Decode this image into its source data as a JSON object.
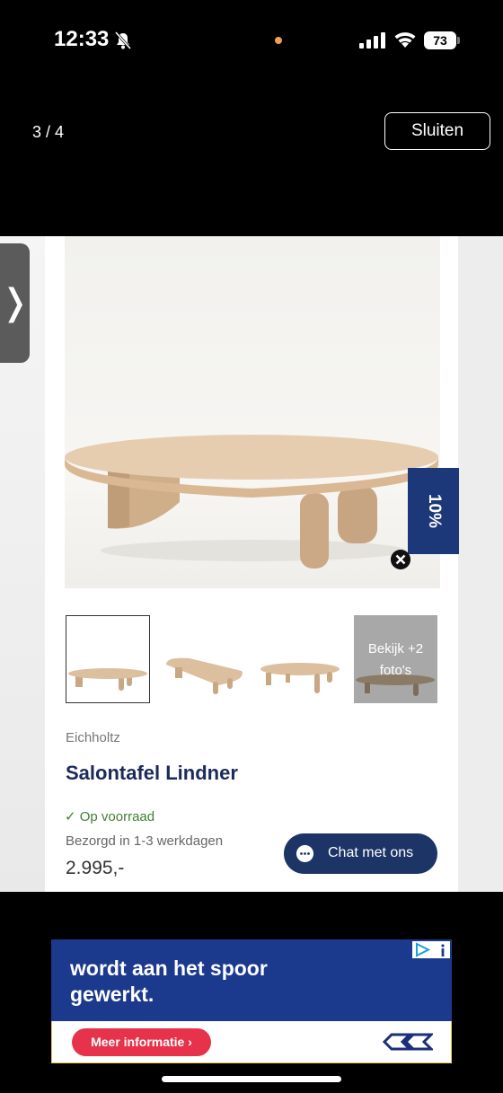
{
  "status_bar": {
    "time": "12:33",
    "battery": "73",
    "dot_color": "#f0a050",
    "icons": [
      "bell-muted-icon",
      "signal-icon",
      "wifi-icon",
      "battery-icon"
    ]
  },
  "viewer": {
    "counter": "3 / 4",
    "close_label": "Sluiten"
  },
  "product_page": {
    "discount_tab": "10%",
    "thumbnails": [
      {
        "selected": true
      },
      {
        "selected": false
      },
      {
        "selected": false
      }
    ],
    "more_photos_label": "Bekijk +2 foto's",
    "brand": "Eichholtz",
    "title": "Salontafel Lindner",
    "stock": "✓ Op voorraad",
    "delivery": "Bezorgd in 1-3 werkdagen",
    "price": "2.995,-",
    "chat_label": "Chat met ons",
    "colors": {
      "navy": "#1c3466",
      "stock_green": "#3f7f30"
    }
  },
  "ad": {
    "headline": "wordt aan het spoor gewerkt.",
    "cta": "Meer informatie ›",
    "colors": {
      "background": "#1b3a8e",
      "cta": "#e6324a"
    },
    "icons": [
      "ad-choices-icon",
      "ns-logo-icon"
    ]
  }
}
